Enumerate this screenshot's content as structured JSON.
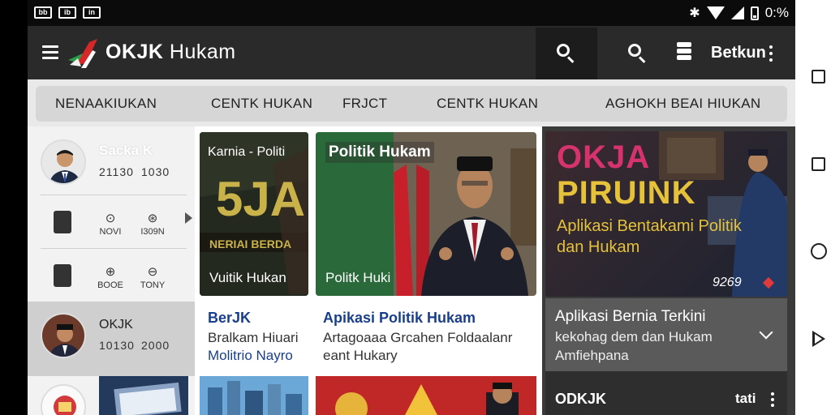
{
  "status_bar": {
    "left_icons": [
      "bb",
      "ib",
      "in"
    ],
    "battery_text": "0:%",
    "icons": [
      "bluetooth-icon",
      "wifi-icon",
      "signal-icon",
      "battery-icon"
    ]
  },
  "app_bar": {
    "title_bold": "OKJK",
    "title_regular": "Hukam",
    "action_label": "Betkun",
    "icons": [
      "menu-icon",
      "logo-icon",
      "search-icon",
      "database-icon",
      "more-icon"
    ]
  },
  "tabs": [
    {
      "label": "NENAAKIUKAN",
      "active": true
    },
    {
      "label": "CENTK HUKAN",
      "active": false
    },
    {
      "label": "FRJCT",
      "active": false
    },
    {
      "label": "CENTK HUKAN",
      "active": false
    },
    {
      "label": "AGHOKH BEAI HIUKAN",
      "active": false
    }
  ],
  "left_panel": {
    "item1": {
      "name": "Sacka K",
      "num_a": "21130",
      "num_b": "1030"
    },
    "icon_row1": {
      "a": "NOVI",
      "b": "I309N"
    },
    "icon_row2": {
      "a": "BOOE",
      "b": "TONY"
    },
    "item2": {
      "name": "OKJK",
      "num_a": "10130",
      "num_b": "2000"
    }
  },
  "cards": {
    "card1": {
      "overlay_title": "Karnia - Politi",
      "big_text": "5JA",
      "strip_text": "NERIAI BERDA",
      "caption": "Vuitik Hukan"
    },
    "card2": {
      "overlay_title": "Politik Hukam",
      "caption": "Politk Huki"
    },
    "headline1": "BerJK",
    "body1_line1": "Bralkam Hiuari",
    "body1_line2": "Molitrio Nayro",
    "headline2": "Apikasi Politik Hukam",
    "body2_line1": "Artagoaaa Grcahen Foldaalanr",
    "body2_line2": "eant Hukary"
  },
  "featured": {
    "line1": "OKJA",
    "line2": "PIRUINK",
    "line3": "Aplikasi Bentakami Politik dan Hukam",
    "meta": "9269",
    "info_title": "Aplikasi Bernia Terkini",
    "info_sub_line1": "kekohag dem dan Hukam",
    "info_sub_line2": "Amfiehpana",
    "footer_name": "ODKJK",
    "footer_right": "tati"
  },
  "colors": {
    "accent_blue": "#1a3f8a",
    "feature_pink": "#d6336c",
    "feature_gold": "#e6c23a",
    "app_bar": "#2a2a2a"
  }
}
